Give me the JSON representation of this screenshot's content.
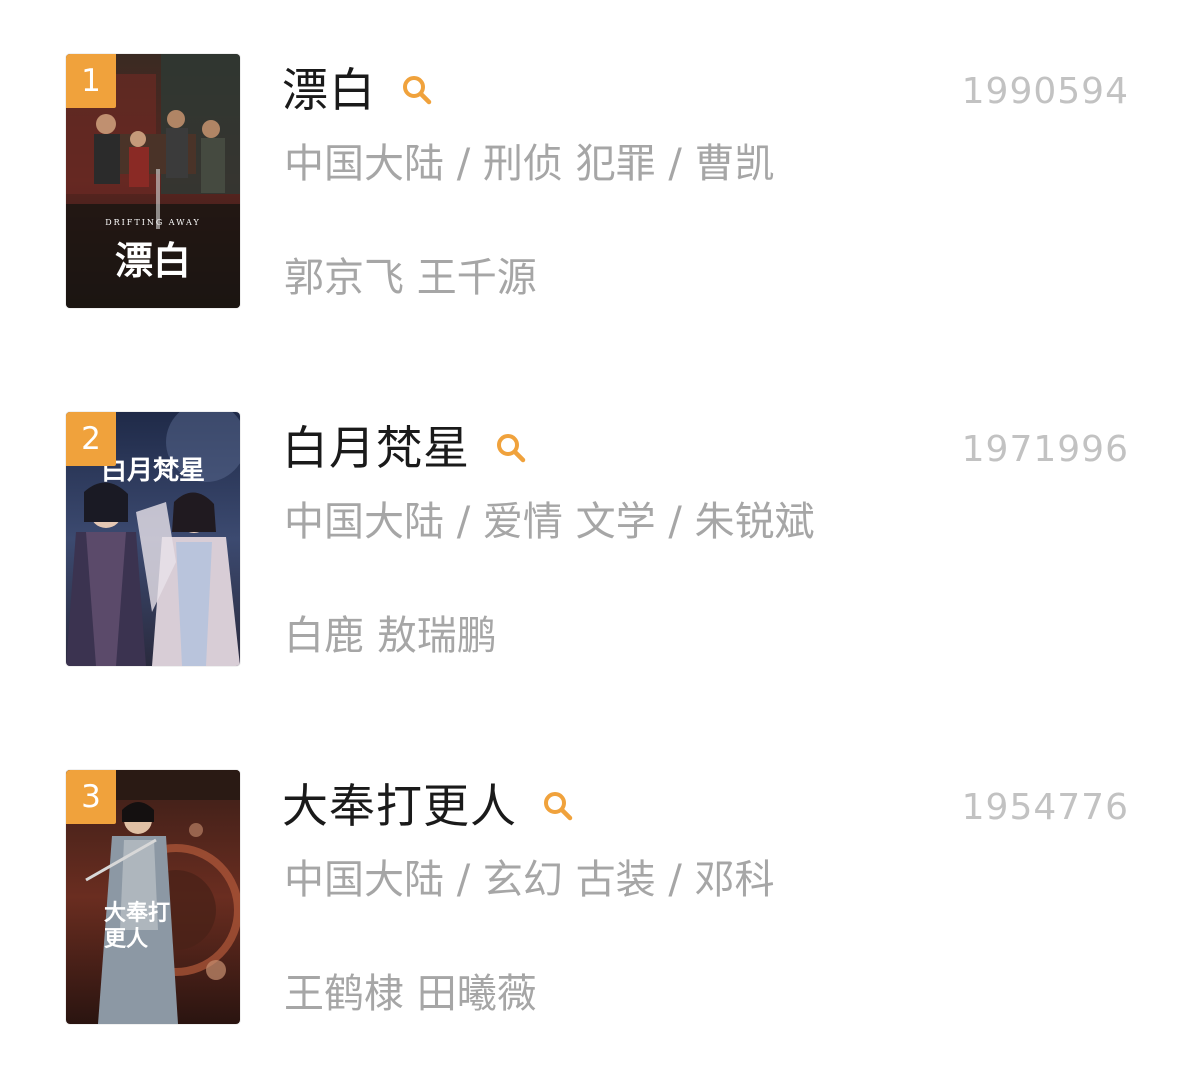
{
  "colors": {
    "badge": "#f0a23c",
    "title": "#1a1a1a",
    "meta": "#a6a6a6",
    "score": "#c2c2c2",
    "search_icon": "#f0a23c"
  },
  "items": [
    {
      "rank": "1",
      "title": "漂白",
      "score": "1990594",
      "meta": "中国大陆 / 刑侦 犯罪 / 曹凯",
      "cast": "郭京飞 王千源",
      "poster_text": "漂白",
      "poster_subtext": "DRIFTING AWAY",
      "icon": "search-icon"
    },
    {
      "rank": "2",
      "title": "白月梵星",
      "score": "1971996",
      "meta": "中国大陆 / 爱情 文学 / 朱锐斌",
      "cast": "白鹿 敖瑞鹏",
      "poster_text": "白月梵星",
      "icon": "search-icon"
    },
    {
      "rank": "3",
      "title": "大奉打更人",
      "score": "1954776",
      "meta": "中国大陆 / 玄幻 古装 / 邓科",
      "cast": "王鹤棣 田曦薇",
      "poster_text": "大奉打更人",
      "icon": "search-icon"
    }
  ]
}
